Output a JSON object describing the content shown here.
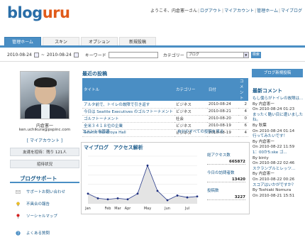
{
  "header": {
    "logo_main": "blog",
    "logo_accent": "uru",
    "welcome": "ようこそ、内倉憲一さん",
    "links": [
      "ログアウト",
      "マイアカウント",
      "管理ホーム",
      "マイブログ"
    ]
  },
  "tabs": [
    {
      "label": "管理ホーム",
      "active": true
    },
    {
      "label": "スキン",
      "active": false
    },
    {
      "label": "オプション",
      "active": false
    },
    {
      "label": "新規投稿",
      "active": false
    }
  ],
  "search": {
    "date_from": "2010-08-24",
    "date_to": "2010-08-24",
    "keyword_label": "キーワード",
    "keyword_value": "",
    "category_label": "カテゴリー",
    "category_value": "ブログ",
    "button": "検索"
  },
  "profile": {
    "name": "内倉憲一",
    "email": "ken.uchikura@pspinc.com",
    "account_link": "[ マイアカウント ]",
    "invite": "友達を招待：残り 121人",
    "invite_status": "招待状況"
  },
  "support": {
    "title": "ブログサポート",
    "items": [
      {
        "label": "サポートお問い合わせ",
        "icon": "mail-icon"
      },
      {
        "label": "不具合の報告",
        "icon": "bulb-icon"
      },
      {
        "label": "ソーシャルマップ",
        "icon": "map-pin-icon"
      },
      {
        "label": "よくある質問",
        "icon": "question-icon"
      }
    ]
  },
  "recent_posts": {
    "title": "最近の投稿",
    "columns": [
      "タイトル",
      "カテゴリー",
      "日付",
      "コメント"
    ],
    "rows": [
      [
        "アルタ前で、トイレの故障で引き返す",
        "ビジネス",
        "2010-08-24",
        "2"
      ],
      [
        "今日は Seattle Executives のゴルフトーナメント",
        "ビジネス",
        "2010-08-21",
        "4"
      ],
      [
        "ゴルフトーナメント",
        "社会",
        "2010-08-20",
        "0"
      ],
      [
        "全米３４１８位の企業",
        "ビジネス",
        "2010-08-19",
        "6"
      ],
      [
        "Seattle Benaroya Hall",
        "ビジネス",
        "2010-08-19",
        "4"
      ]
    ],
    "manage_comments": "コメントの管理",
    "manage_all": "自分のすべての投稿を見る"
  },
  "stats": {
    "title": "マイブログ　アクセス解析",
    "total_label": "総アクセス数",
    "total_value": "665872",
    "today_label": "今日の訪問者数",
    "today_value": "13420",
    "posts_label": "投稿数",
    "posts_value": "3227"
  },
  "chart_data": {
    "type": "area",
    "categories": [
      "Jan",
      "Feb",
      "Mar",
      "Apr",
      "May",
      "Jun",
      "Jul"
    ],
    "x": [
      "Jan",
      "Jan-Feb",
      "Feb",
      "Mar",
      "Apr",
      "Apr-May",
      "May",
      "May-Jun",
      "Jun",
      "Jun-Jul",
      "Jul",
      "Jul+"
    ],
    "values": [
      10,
      5,
      4,
      5,
      4,
      10,
      40,
      13,
      3,
      8,
      6,
      7
    ],
    "ylim": [
      0,
      50
    ],
    "grid": true,
    "title": "",
    "xlabel": "",
    "ylabel": ""
  },
  "right": {
    "new_post": "ブログ新規投稿",
    "recent_comments_title": "最新コメント",
    "comments": [
      {
        "text": "もし僕らがトイレの故障は...",
        "by": "By 内倉憲一",
        "date": "On 2010-08-24 01:23"
      },
      {
        "text": "まったく酷い目に遭いましたね。",
        "by": "By 秋葉",
        "date": "On 2010-08-24 01:14"
      },
      {
        "text": "行ってみたいです！",
        "by": "By 内倉憲一",
        "date": "On 2010-08-22 11:59"
      },
      {
        "text": "1：00か5:ske ゴ...",
        "by": "By binty",
        "date": "On 2010-08-22 02:46"
      },
      {
        "text": "スクランブルとレッツ...",
        "by": "By 内倉憲一",
        "date": "On 2010-08-22 00:26"
      },
      {
        "text": "スコアはいかがですか？",
        "by": "By Toshiaki Nomura",
        "date": "On 2010-08-21 15:51"
      }
    ]
  },
  "colors": {
    "accent": "#4a8ec4",
    "link": "#1a5a8a",
    "logo_blue": "#2a6ea8",
    "logo_orange": "#e05a1a"
  }
}
